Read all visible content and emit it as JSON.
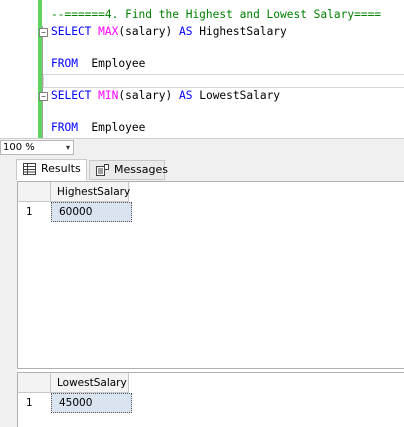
{
  "editor": {
    "comment": "--======4. Find the Highest and Lowest Salary====",
    "lines": [
      {
        "kw1": "SELECT ",
        "fn": "MAX",
        "rest": "(salary) ",
        "kw2": "AS",
        "alias": " HighestSalary"
      },
      {
        "kw": "FROM",
        "table": "  Employee"
      },
      {
        "kw1": "SELECT ",
        "fn": "MIN",
        "rest": "(salary) ",
        "kw2": "AS",
        "alias": " LowestSalary"
      },
      {
        "kw": "FROM",
        "table": "  Employee"
      }
    ],
    "collapse_symbol": "−"
  },
  "zoom": {
    "value": "100 %",
    "arrow": "▾"
  },
  "tabs": [
    {
      "label": "Results",
      "icon": "grid-icon"
    },
    {
      "label": "Messages",
      "icon": "messages-icon"
    }
  ],
  "results": [
    {
      "column": "HighestSalary",
      "rows": [
        {
          "num": "1",
          "value": "60000"
        }
      ]
    },
    {
      "column": "LowestSalary",
      "rows": [
        {
          "num": "1",
          "value": "45000"
        }
      ]
    }
  ],
  "colors": {
    "keyword": "#0000ff",
    "function": "#ff00ff",
    "comment": "#008000",
    "selection": "#dae4f0",
    "change_bar": "#5fd35f"
  }
}
